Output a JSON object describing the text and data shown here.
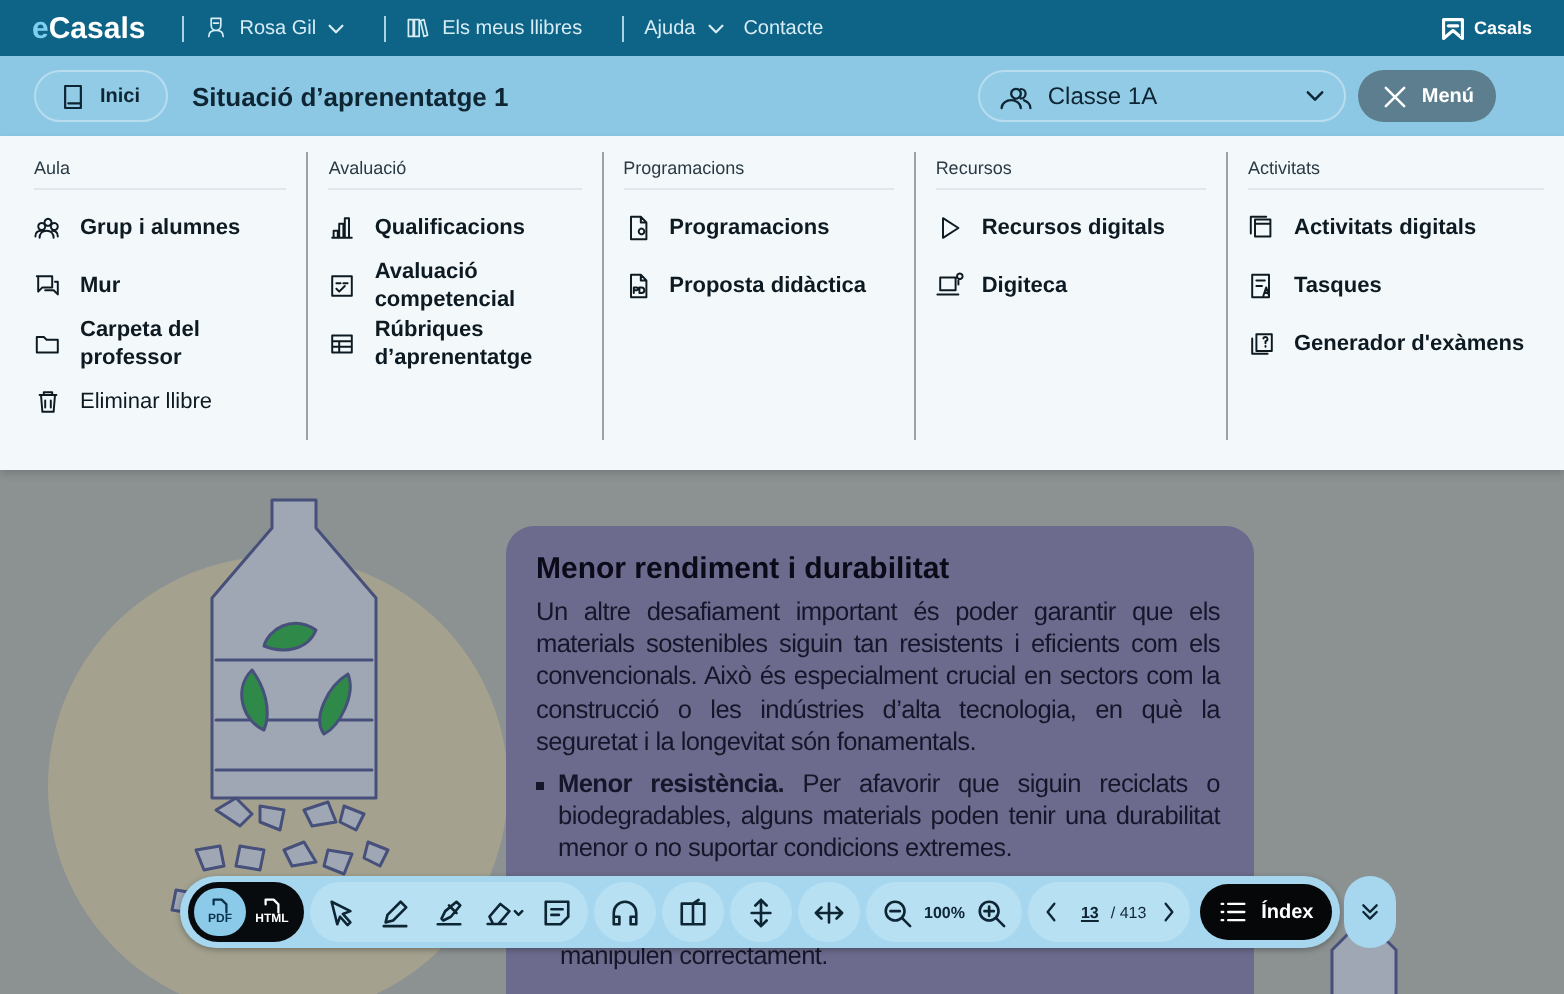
{
  "top_bar": {
    "logo": "eCasals",
    "items": [
      {
        "label": "Rosa Gil",
        "dropdown": true
      },
      {
        "label": "Els meus llibres",
        "dropdown": false
      },
      {
        "label": "Ajuda",
        "dropdown": true
      },
      {
        "label": "Contacte",
        "dropdown": false
      }
    ],
    "brand": "Casals"
  },
  "header": {
    "home_button": "Inici",
    "title": "Situació d’aprenentatge 1",
    "class_select": "Classe 1A",
    "menu_button": "Menú"
  },
  "menu": [
    {
      "title": "Aula",
      "items": [
        {
          "label": "Grup i alumnes",
          "kind": "link"
        },
        {
          "label": "Mur",
          "kind": "link"
        },
        {
          "label": "Carpeta del professor",
          "kind": "link"
        },
        {
          "label": "Eliminar llibre",
          "kind": "action"
        }
      ]
    },
    {
      "title": "Avaluació",
      "items": [
        {
          "label": "Qualificacions",
          "kind": "link"
        },
        {
          "label": "Avaluació competencial",
          "kind": "link"
        },
        {
          "label": "Rúbriques d’aprenentatge",
          "kind": "link"
        }
      ]
    },
    {
      "title": "Programacions",
      "items": [
        {
          "label": "Programacions",
          "kind": "link"
        },
        {
          "label": "Proposta didàctica",
          "kind": "link"
        }
      ]
    },
    {
      "title": "Recursos",
      "items": [
        {
          "label": "Recursos digitals",
          "kind": "link"
        },
        {
          "label": "Digiteca",
          "kind": "link"
        }
      ]
    },
    {
      "title": "Activitats",
      "items": [
        {
          "label": "Activitats digitals",
          "kind": "link"
        },
        {
          "label": "Tasques",
          "kind": "link"
        },
        {
          "label": "Generador d'exàmens",
          "kind": "link"
        }
      ]
    }
  ],
  "page": {
    "heading": "Menor rendiment i durabilitat",
    "paragraph": "Un altre desafiament important és poder garantir que els materials sostenibles siguin tan resistents i eficients com els convencionals. Això és especialment crucial en sectors com la construcció o les indústries d’alta tecnologia, en què la seguretat i la longevitat són fonamentals.",
    "bullets": [
      "**Menor resistència.** Per afavorir que siguin reciclats o biodegradables, alguns materials poden tenir una durabilitat menor o no suportar condicions extremes."
    ],
    "trailing_line": "manipulen correctament."
  },
  "toolbar": {
    "formats": [
      {
        "label": "PDF",
        "selected": true
      },
      {
        "label": "HTML",
        "selected": false
      }
    ],
    "zoom": "100%",
    "current_page": "13",
    "total_pages": "/ 413",
    "index_button": "Índex"
  }
}
